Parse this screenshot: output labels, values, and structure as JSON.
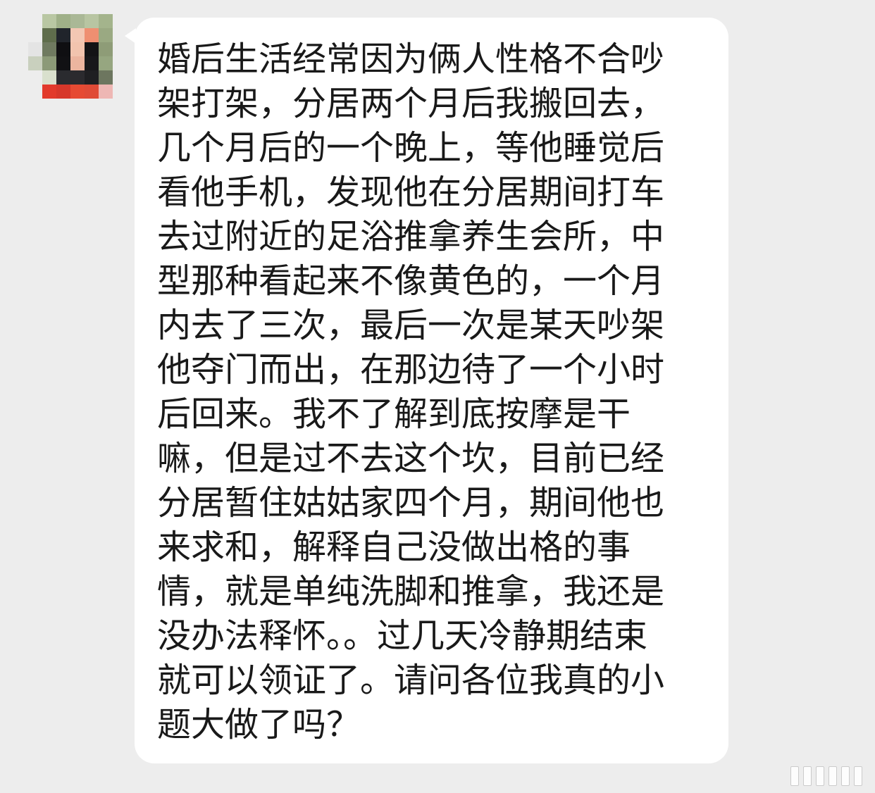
{
  "chat": {
    "sender": {
      "avatar_icon": "pixelated-avatar-icon"
    },
    "message": {
      "text": "婚后生活经常因为俩人性格不合吵\n架打架，分居两个月后我搬回去，\n几个月后的一个晚上，等他睡觉后\n看他手机，发现他在分居期间打车\n去过附近的足浴推拿养生会所，中\n型那种看起来不像黄色的，一个月\n内去了三次，最后一次是某天吵架\n他夺门而出，在那边待了一个小时\n后回来。我不了解到底按摩是干\n嘛，但是过不去这个坎，目前已经\n分居暂住姑姑家四个月，期间他也\n来求和，解释自己没做出格的事\n情，就是单纯洗脚和推拿，我还是\n没办法释怀。。过几天冷静期结束\n就可以领证了。请问各位我真的小\n题大做了吗？"
    }
  },
  "colors": {
    "background": "#ededed",
    "bubble": "#ffffff",
    "text": "#191919"
  },
  "watermark_icon": "watermark-logo-icon"
}
